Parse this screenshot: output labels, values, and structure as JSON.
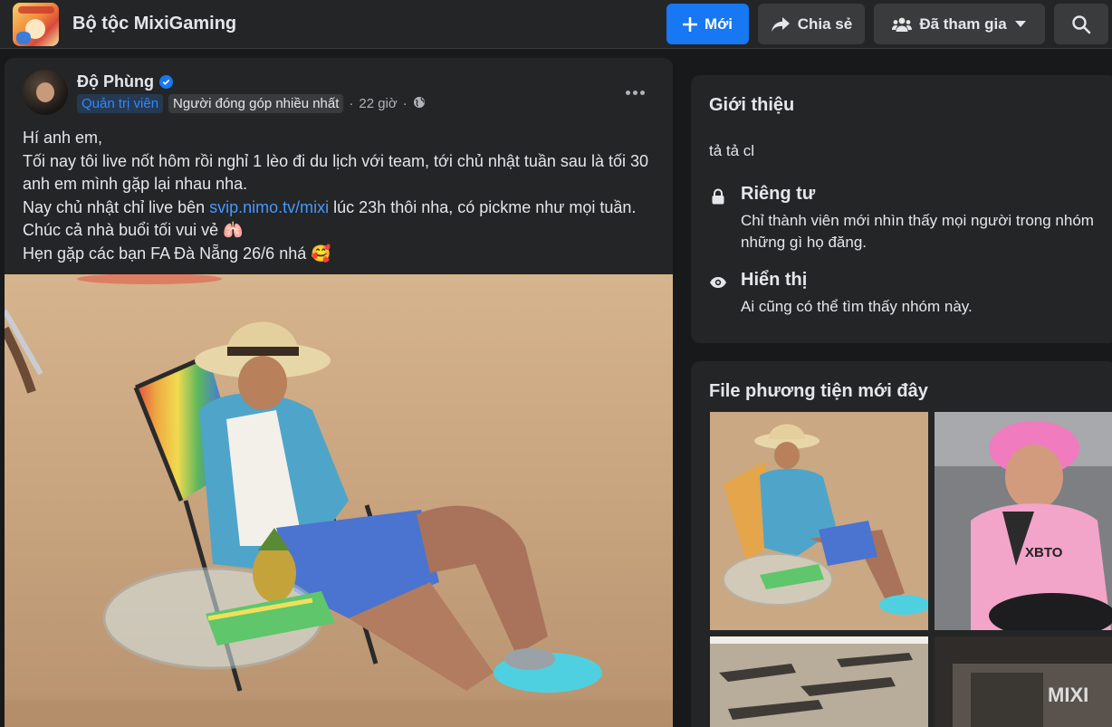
{
  "header": {
    "group_name": "Bộ tộc MixiGaming",
    "buttons": {
      "new_label": "Mới",
      "share_label": "Chia sẻ",
      "joined_label": "Đã tham gia"
    }
  },
  "post": {
    "author": "Độ Phùng",
    "verified": true,
    "badges": {
      "admin": "Quản trị viên",
      "contributor": "Người đóng góp nhiều nhất"
    },
    "time": "22 giờ",
    "text": {
      "line1": "Hí anh em,",
      "line2": "Tối nay tôi live nốt hôm rồi nghỉ 1 lèo đi du lịch với team, tới chủ nhật tuần sau là tối 30 anh em mình gặp lại nhau nha.",
      "line3_before": "Nay chủ nhật chỉ live bên ",
      "line3_link": "svip.nimo.tv/mixi",
      "line3_after": " lúc 23h thôi nha, có pickme như mọi tuần. Chúc cả nhà buổi tối vui vẻ 🫁",
      "line4": "Hẹn gặp các bạn FA Đà Nẵng 26/6 nhá 🥰"
    }
  },
  "about": {
    "title": "Giới thiệu",
    "description": "tả tả cl",
    "privacy": {
      "title": "Riêng tư",
      "description_line1": "Chỉ thành viên mới nhìn thấy mọi người trong nhóm",
      "description_line2": "những gì họ đăng."
    },
    "visibility": {
      "title": "Hiển thị",
      "description": "Ai cũng có thể tìm thấy nhóm này."
    }
  },
  "media": {
    "title": "File phương tiện mới đây",
    "thumb_labels": {
      "jersey_brand": "XBTO",
      "poster_text": "MIXI"
    }
  },
  "colors": {
    "accent": "#1877f2",
    "background": "#18191a",
    "card": "#242526",
    "link": "#4599ff"
  }
}
